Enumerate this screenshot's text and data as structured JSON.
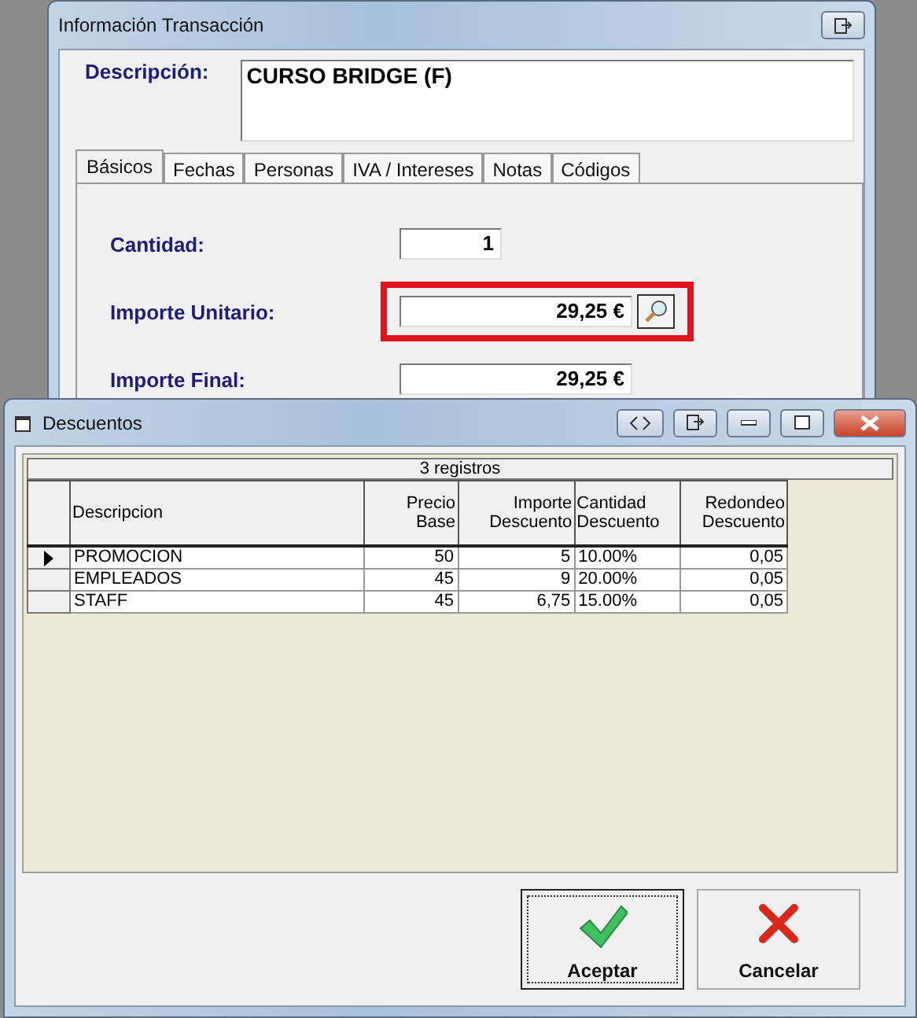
{
  "back_window": {
    "title": "Información Transacción",
    "description_label": "Descripción:",
    "description": "CURSO BRIDGE (F)",
    "tabs": [
      {
        "label": "Básicos",
        "selected": true
      },
      {
        "label": "Fechas",
        "selected": false
      },
      {
        "label": "Personas",
        "selected": false
      },
      {
        "label": "IVA / Intereses",
        "selected": false
      },
      {
        "label": "Notas",
        "selected": false
      },
      {
        "label": "Códigos",
        "selected": false
      }
    ],
    "fields": [
      {
        "kind": "quantity",
        "label": "Cantidad:",
        "value": "1",
        "highlighted": false
      },
      {
        "kind": "lookup",
        "label": "Importe Unitario:",
        "value": "29,25 €",
        "highlighted": true
      },
      {
        "kind": "amount",
        "label": "Importe Final:",
        "value": "29,25 €",
        "highlighted": false
      }
    ]
  },
  "front_window": {
    "title": "Descuentos",
    "grid": {
      "caption": "3 registros",
      "columns": [
        {
          "label": "Descripcion"
        },
        {
          "label": "Precio Base"
        },
        {
          "label": "Importe Descuento"
        },
        {
          "label": "Cantidad Descuento"
        },
        {
          "label": "Redondeo Descuento"
        }
      ],
      "rows": [
        {
          "selected": true,
          "cells": [
            "PROMOCION",
            "50",
            "5",
            "10.00%",
            "0,05"
          ]
        },
        {
          "selected": false,
          "cells": [
            "EMPLEADOS",
            "45",
            "9",
            "20.00%",
            "0,05"
          ]
        },
        {
          "selected": false,
          "cells": [
            "STAFF",
            "45",
            "6,75",
            "15.00%",
            "0,05"
          ]
        }
      ]
    },
    "buttons": [
      {
        "kind": "accept",
        "label": "Aceptar",
        "focused": true
      },
      {
        "kind": "cancel",
        "label": "Cancelar",
        "focused": false
      }
    ]
  }
}
